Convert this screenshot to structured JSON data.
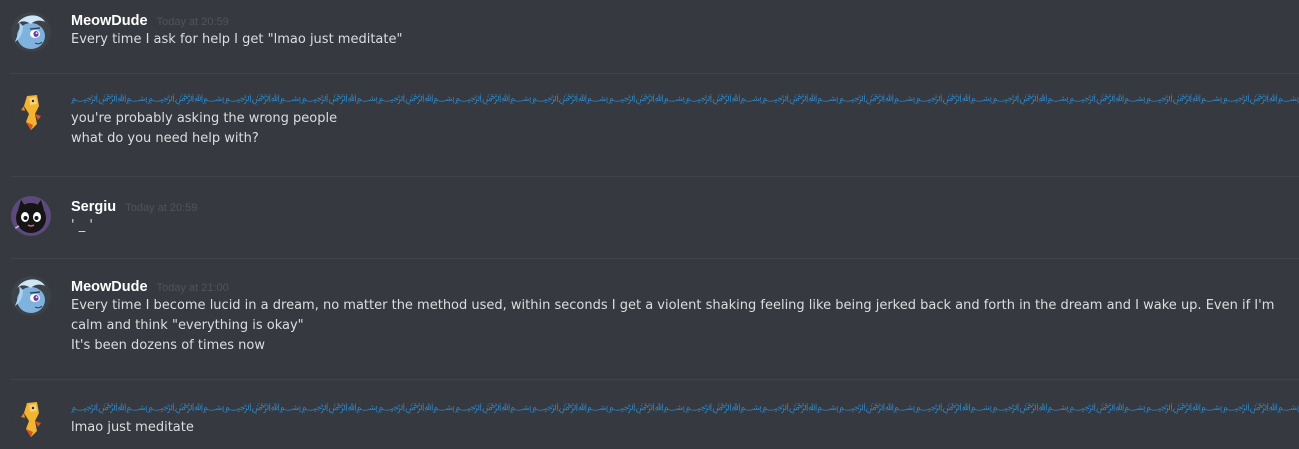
{
  "colors": {
    "background": "#36393f",
    "username": "#ffffff",
    "timestamp": "#4f545c",
    "message_text": "#dcddde",
    "arabic_name": "#2a8fd8",
    "divider": "#40434a"
  },
  "messages": [
    {
      "avatar": "trixie-pony-avatar",
      "username": "MeowDude",
      "timestamp": "Today at 20:59",
      "lines": [
        "Every time I ask for help I get \"lmao just meditate\""
      ]
    },
    {
      "avatar": "cartoon-character-avatar",
      "username": "﷽﷽﷽﷽﷽﷽﷽﷽﷽﷽﷽﷽﷽﷽﷽﷽﷽﷽﷽﷽﷽﷽﷽﷽﷽﷽﷽﷽﷽",
      "timestamp": "",
      "lines": [
        "you're probably asking the wrong people",
        "what do you need help with?"
      ]
    },
    {
      "avatar": "black-cat-avatar",
      "username": "Sergiu",
      "timestamp": "Today at 20:59",
      "lines": [
        "' _ '"
      ]
    },
    {
      "avatar": "trixie-pony-avatar",
      "username": "MeowDude",
      "timestamp": "Today at 21:00",
      "lines": [
        "Every time I become lucid in a dream, no matter the method used, within seconds I get a violent shaking feeling like being jerked back and forth in the dream and I wake up. Even if I'm calm and think \"everything is okay\"",
        "It's been dozens of times now"
      ]
    },
    {
      "avatar": "cartoon-character-avatar",
      "username": "﷽﷽﷽﷽﷽﷽﷽﷽﷽﷽﷽﷽﷽﷽﷽﷽﷽﷽﷽﷽﷽﷽﷽﷽﷽﷽﷽﷽﷽",
      "timestamp": "",
      "lines": [
        "lmao just meditate"
      ]
    }
  ]
}
